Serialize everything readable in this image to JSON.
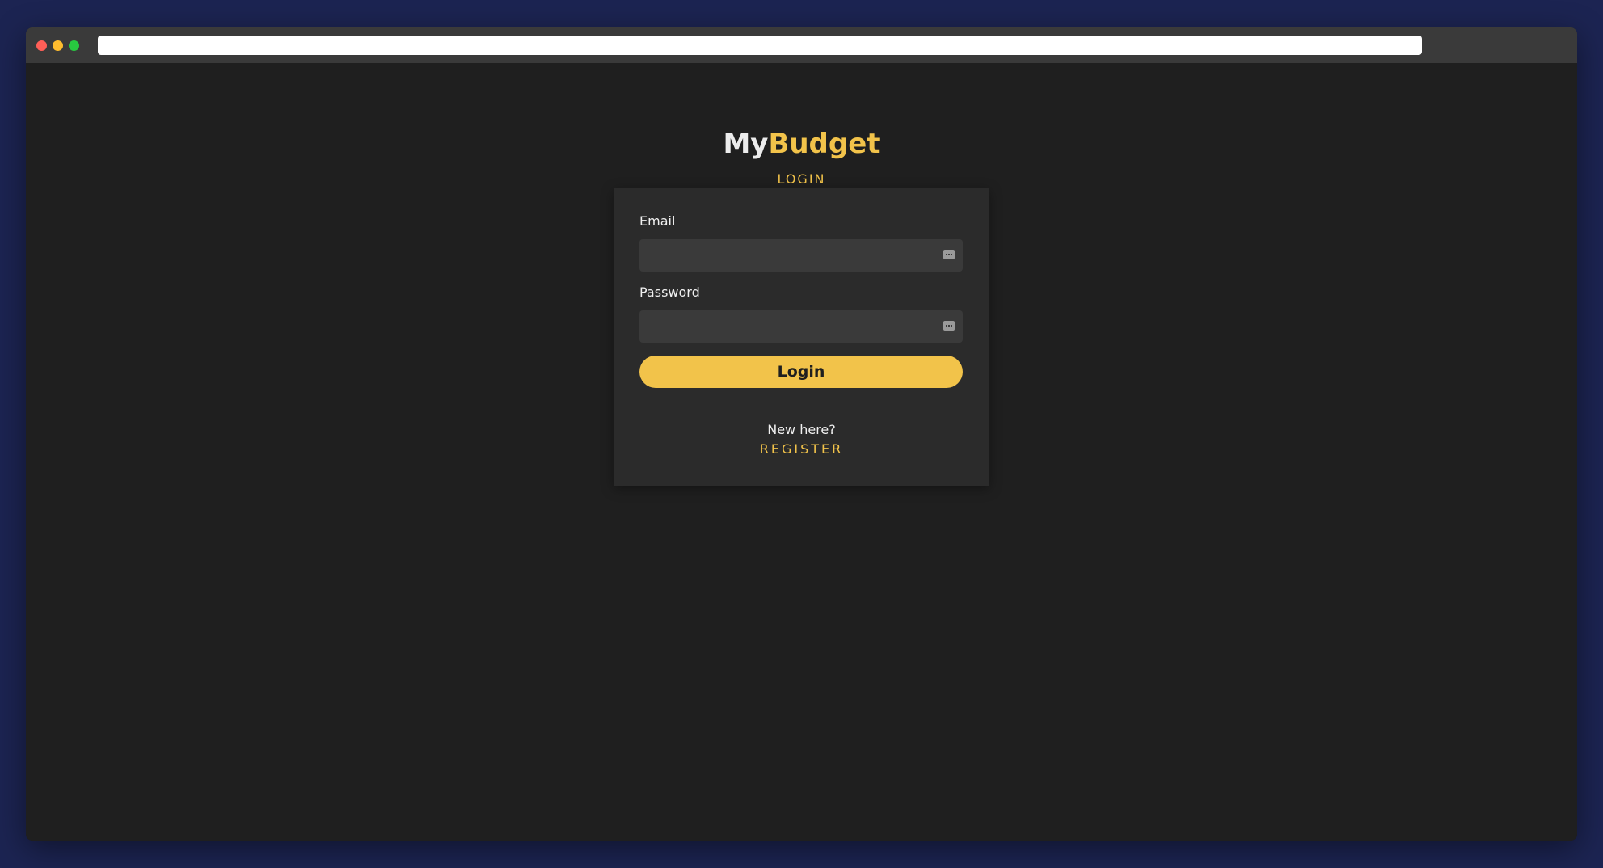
{
  "colors": {
    "accent": "#f2c34a",
    "page_background": "#1f1f1f",
    "card_background": "#2b2b2b",
    "input_background": "#3a3a3a",
    "desktop_background": "#1c2452",
    "window_close": "#ff5f57",
    "window_minimize": "#febc2e",
    "window_maximize": "#28c840"
  },
  "browser": {
    "url": ""
  },
  "header": {
    "brand_part1": "My",
    "brand_part2": "Budget",
    "subtitle": "LOGIN"
  },
  "form": {
    "email_label": "Email",
    "email_value": "",
    "password_label": "Password",
    "password_value": "",
    "field_icon": "keyboard-icon",
    "login_label": "Login"
  },
  "footer": {
    "prompt": "New here?",
    "register_label": "REGISTER"
  }
}
